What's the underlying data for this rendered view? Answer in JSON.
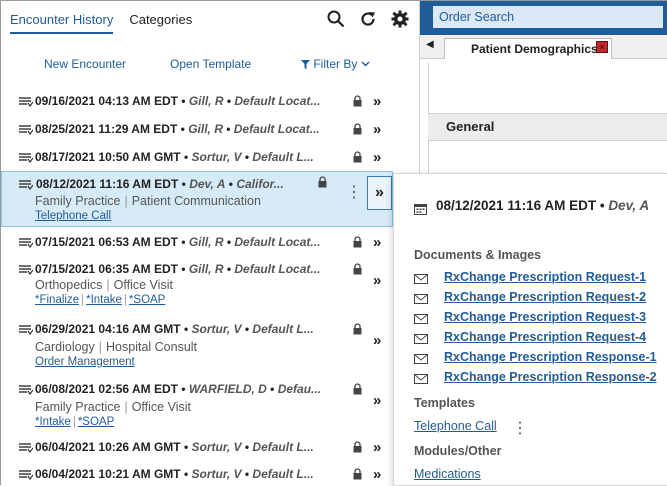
{
  "left": {
    "tabs": [
      "Encounter History",
      "Categories"
    ],
    "actions": {
      "new_encounter": "New Encounter",
      "open_template": "Open Template",
      "filter_by": "Filter By"
    },
    "encounters": [
      {
        "date": "09/16/2021 04:13 AM EDT",
        "provider": "Gill, R",
        "location": "Default Locat..."
      },
      {
        "date": "08/25/2021 11:29 AM EDT",
        "provider": "Gill, R",
        "location": "Default Locat..."
      },
      {
        "date": "08/17/2021 10:50 AM GMT",
        "provider": "Sortur, V",
        "location": "Default L..."
      },
      {
        "date": "08/12/2021 11:16 AM EDT",
        "provider": "Dev, A",
        "location": "Califor...",
        "sub": [
          "Family Practice",
          "Patient Communication"
        ],
        "links": [
          "Telephone Call"
        ]
      },
      {
        "date": "07/15/2021 06:53 AM EDT",
        "provider": "Gill, R",
        "location": "Default Locat..."
      },
      {
        "date": "07/15/2021 06:35 AM EDT",
        "provider": "Gill, R",
        "location": "Default Locat...",
        "sub": [
          "Orthopedics",
          "Office Visit"
        ],
        "links": [
          "*Finalize",
          "*Intake",
          "*SOAP"
        ]
      },
      {
        "date": "06/29/2021 04:16 AM GMT",
        "provider": "Sortur, V",
        "location": "Default L...",
        "sub": [
          "Cardiology",
          "Hospital Consult"
        ],
        "links": [
          "Order Management"
        ]
      },
      {
        "date": "06/08/2021 02:56 AM EDT",
        "provider": "WARFIELD, D",
        "location": "Defau...",
        "sub": [
          "Family Practice",
          "Office Visit"
        ],
        "links": [
          "*Intake",
          "*SOAP"
        ]
      },
      {
        "date": "06/04/2021 10:26 AM GMT",
        "provider": "Sortur, V",
        "location": "Default L..."
      },
      {
        "date": "06/04/2021 10:21 AM GMT",
        "provider": "Sortur, V",
        "location": "Default L..."
      }
    ]
  },
  "right": {
    "search_placeholder": "Order Search",
    "tab_label": "Patient Demographics",
    "section": "General"
  },
  "popover": {
    "date": "08/12/2021 11:16 AM EDT",
    "provider": "Dev, A",
    "documents_heading": "Documents & Images",
    "documents": [
      "RxChange Prescription Request-1",
      "RxChange Prescription Request-2",
      "RxChange Prescription Request-3",
      "RxChange Prescription Request-4",
      "RxChange Prescription Response-1",
      "RxChange Prescription Response-2"
    ],
    "templates_heading": "Templates",
    "template": "Telephone Call",
    "modules_heading": "Modules/Other",
    "module": "Medications"
  },
  "colors": {
    "accent": "#1f5c99",
    "selected_row": "#d6ebf7",
    "close_red": "#c4272a"
  }
}
